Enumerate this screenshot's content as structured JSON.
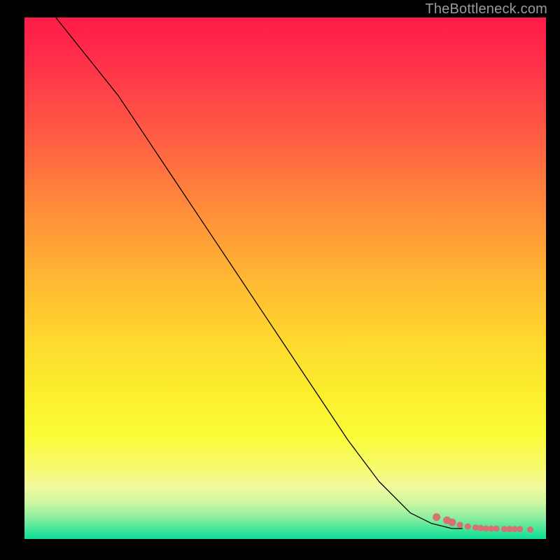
{
  "attribution": "TheBottleneck.com",
  "colors": {
    "page_bg": "#000000",
    "attribution_text": "#9a9a9a",
    "curve": "#000000",
    "dot": "#d87172",
    "gradient_stops": [
      "#ff1a47",
      "#ff2f4a",
      "#ff5a44",
      "#ff8a3a",
      "#ffb733",
      "#ffd92f",
      "#fbee2d",
      "#fbfb37",
      "#f7fa6b",
      "#f1f99d",
      "#cef7a0",
      "#8aeea0",
      "#28e398",
      "#0fdd99"
    ]
  },
  "chart_data": {
    "type": "line",
    "title": "",
    "xlabel": "",
    "ylabel": "",
    "xlim": [
      0,
      100
    ],
    "ylim": [
      0,
      100
    ],
    "note": "Axes are unlabeled percentages; values are read from pixel positions.",
    "series": [
      {
        "name": "curve",
        "x": [
          6,
          10,
          14,
          18,
          22,
          24,
          26,
          28,
          32,
          38,
          44,
          50,
          56,
          62,
          68,
          74,
          78,
          82,
          84
        ],
        "y": [
          100,
          95,
          90,
          85,
          79,
          76,
          73,
          70,
          64,
          55,
          46,
          37,
          28,
          19,
          11,
          5,
          3,
          2,
          2
        ]
      }
    ],
    "points": {
      "name": "dots",
      "x": [
        79,
        81,
        82,
        83.5,
        85,
        86.5,
        87.5,
        88.5,
        89.5,
        90.5,
        92,
        93,
        94,
        95,
        97
      ],
      "y": [
        4.2,
        3.6,
        3.2,
        2.7,
        2.4,
        2.2,
        2.1,
        2.0,
        2.0,
        2.0,
        1.9,
        1.9,
        1.9,
        1.9,
        1.8
      ]
    }
  }
}
